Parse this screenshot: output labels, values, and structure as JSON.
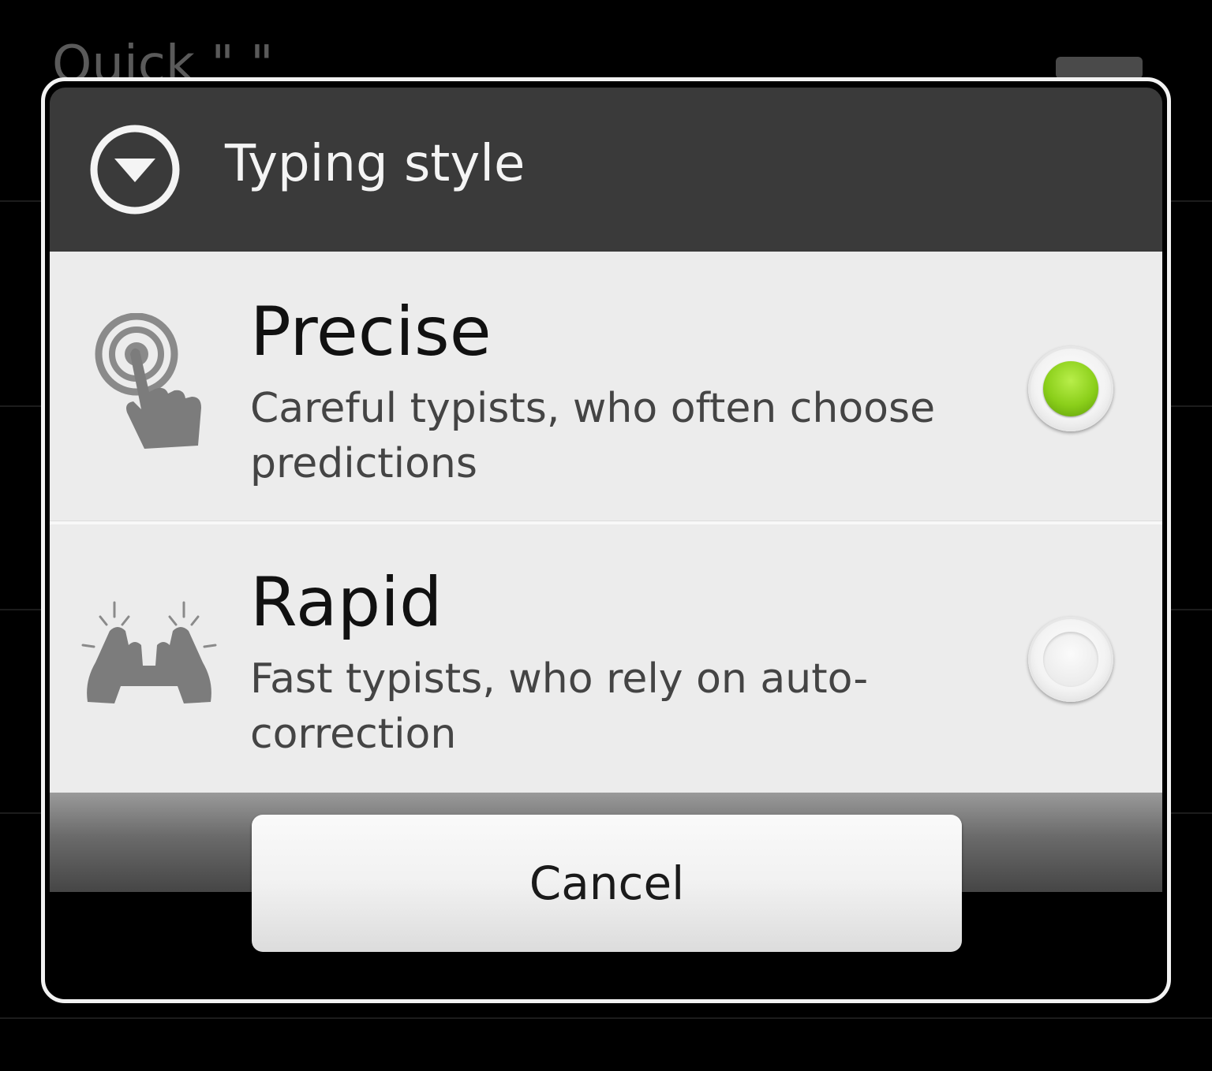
{
  "background": {
    "screen_title": "Quick \" \""
  },
  "dialog": {
    "title": "Typing style",
    "options": [
      {
        "title": "Precise",
        "description": "Careful typists, who often choose predictions",
        "icon": "precise-touch-icon",
        "selected": true
      },
      {
        "title": "Rapid",
        "description": "Fast typists, who rely on auto-correction",
        "icon": "rapid-typing-icon",
        "selected": false
      }
    ],
    "cancel_label": "Cancel"
  },
  "colors": {
    "title_bar": "#3a3a3a",
    "list_background": "#ececec",
    "radio_selected": "#8bcf1a"
  }
}
